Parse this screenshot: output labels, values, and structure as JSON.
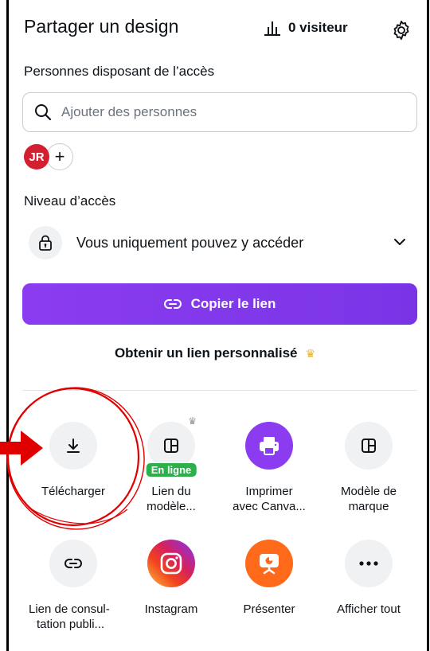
{
  "header": {
    "title": "Partager un design",
    "visitors_label": "0 visiteur"
  },
  "people": {
    "label": "Personnes disposant de l’accès",
    "search_placeholder": "Ajouter des personnes",
    "avatar_initials": "JR"
  },
  "access": {
    "label": "Niveau d’accès",
    "value": "Vous uniquement pouvez y accéder"
  },
  "copy_link_label": "Copier le lien",
  "custom_link_label": "Obtenir un lien personnalisé",
  "share_options": {
    "download": "Télécharger",
    "template_link_line1": "Lien du",
    "template_link_line2": "modèle...",
    "template_badge": "En ligne",
    "print_line1": "Imprimer",
    "print_line2": "avec Canva...",
    "brand_template_line1": "Modèle de",
    "brand_template_line2": "marque",
    "public_view_line1": "Lien de consul-",
    "public_view_line2": "tation publi...",
    "instagram": "Instagram",
    "present": "Présenter",
    "see_all": "Afficher tout"
  },
  "colors": {
    "accent_purple": "#8b3cf0",
    "avatar_red": "#d32030",
    "badge_green": "#2bb04a",
    "annotation_red": "#e00000",
    "present_orange": "#ff6a1a"
  }
}
